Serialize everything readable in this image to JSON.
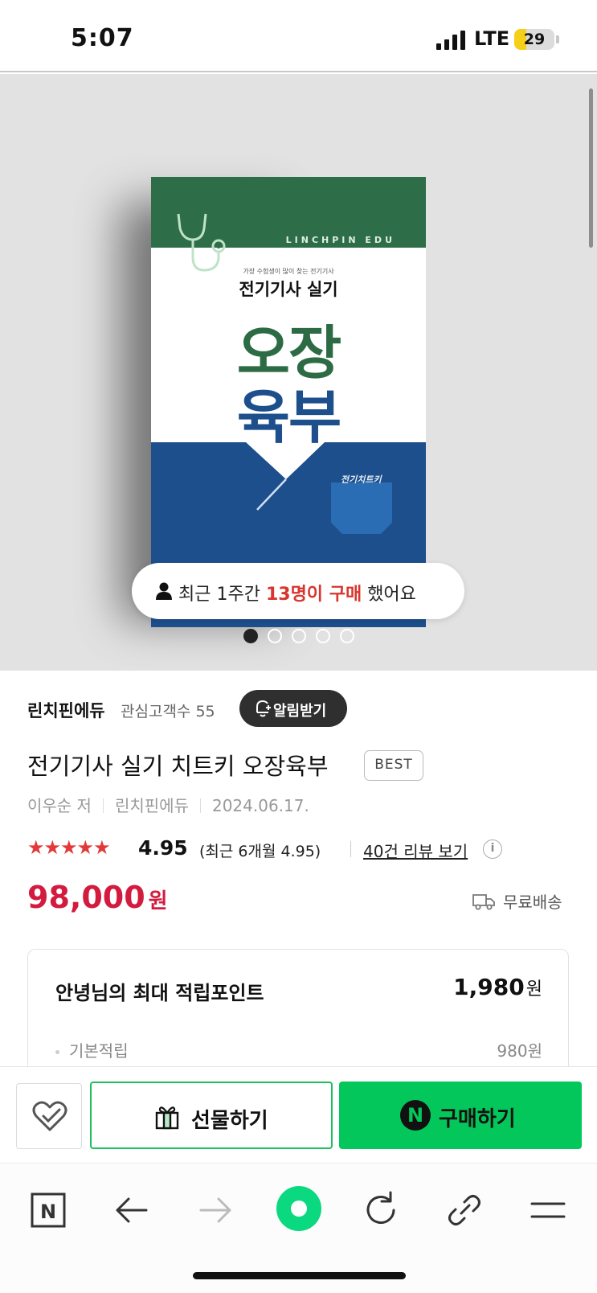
{
  "status_bar": {
    "time": "5:07",
    "network": "LTE",
    "battery": "29",
    "battery_fraction": 0.29
  },
  "gallery": {
    "book": {
      "brand": "LINCHPIN EDU",
      "tagline": "가장 수험생이 많이 찾는 전기기사",
      "subtitle": "전기기사 실기",
      "title_line1": "오장",
      "title_line2": "육부",
      "pocket_label": "전기치트키"
    },
    "buyers_badge": {
      "prefix": "최근 1주간 ",
      "highlight": "13명이 구매",
      "suffix": " 했어요"
    },
    "page_count": 5,
    "active_page": 1
  },
  "seller": {
    "name": "린치핀에듀",
    "followers": "관심고객수 55",
    "alarm_button": "알림받기"
  },
  "product": {
    "title": "전기기사 실기 치트키 오장육부",
    "badge": "BEST",
    "author": "이우순 저",
    "publisher": "린치핀에듀",
    "date": "2024.06.17.",
    "stars": "★★★★★",
    "rating": "4.95",
    "recent_rating": "(최근 6개월 4.95)",
    "reviews_link": "40건 리뷰 보기",
    "info_icon": "i",
    "price": "98,000",
    "currency": "원",
    "shipping": "무료배송"
  },
  "points": {
    "heading": "안녕님의 최대 적립포인트",
    "total": "1,980",
    "total_unit": "원",
    "basic_label": "기본적립",
    "basic_value": "980원"
  },
  "purchase_bar": {
    "wish_icon": "heart-check-icon",
    "gift_label": "선물하기",
    "buy_badge": "N",
    "buy_label": "구매하기"
  },
  "browser_nav": {
    "home_letter": "N",
    "icons": [
      "naver-home-icon",
      "back-arrow-icon",
      "forward-arrow-icon",
      "green-dot-icon",
      "reload-icon",
      "link-icon",
      "menu-icon"
    ]
  },
  "colors": {
    "price_red": "#d31b3f",
    "naver_green": "#03c75a",
    "star_red": "#e23a3a",
    "book_green": "#2d6e48",
    "book_blue": "#1c4f8c"
  }
}
